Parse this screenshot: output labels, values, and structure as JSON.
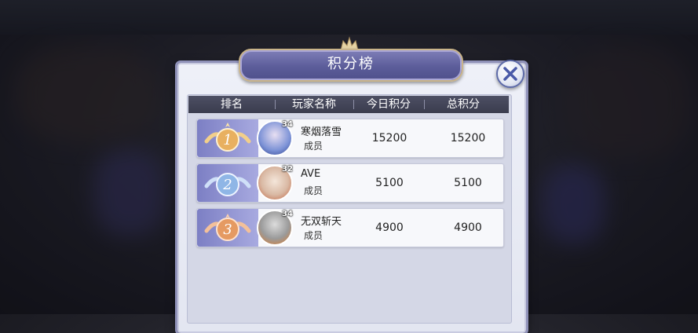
{
  "dialog": {
    "title": "积分榜"
  },
  "table": {
    "headers": [
      "排名",
      "玩家名称",
      "今日积分",
      "总积分"
    ],
    "rows": [
      {
        "rank": "1",
        "name": "寒烟落雪",
        "role": "成员",
        "level": "34",
        "today": "15200",
        "total": "15200"
      },
      {
        "rank": "2",
        "name": "AVE",
        "role": "成员",
        "level": "32",
        "today": "5100",
        "total": "5100"
      },
      {
        "rank": "3",
        "name": "无双斩天",
        "role": "成员",
        "level": "34",
        "today": "4900",
        "total": "4900"
      }
    ]
  },
  "icons": {
    "close": "close-icon",
    "rank_badge": "rank-badge-icon",
    "avatar": "avatar"
  },
  "colors": {
    "accent": "#5c5d9a",
    "rank1": "#e8b060",
    "rank2": "#8fb6e6",
    "rank3": "#e59a62"
  }
}
